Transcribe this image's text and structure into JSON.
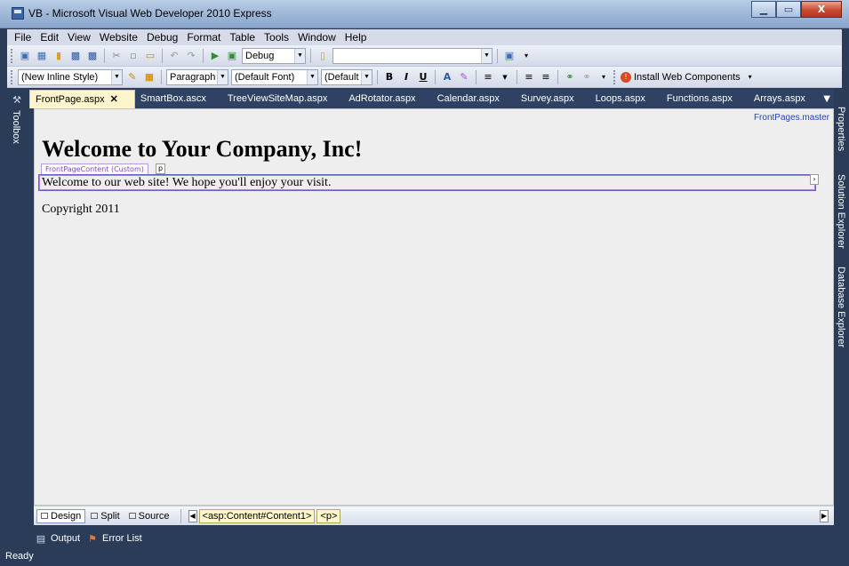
{
  "window": {
    "title": "VB - Microsoft Visual Web Developer 2010 Express",
    "minimize": "▁",
    "restore": "▭",
    "close": "X"
  },
  "menu": [
    "File",
    "Edit",
    "View",
    "Website",
    "Debug",
    "Format",
    "Table",
    "Tools",
    "Window",
    "Help"
  ],
  "toolbar1": {
    "config": "Debug",
    "platform": ""
  },
  "toolbar2": {
    "style": "(New Inline Style)",
    "block": "Paragraph",
    "font": "(Default Font)",
    "size": "(Default",
    "bold": "B",
    "italic": "I",
    "underline": "U",
    "install": "Install Web Components"
  },
  "left_panel": {
    "toolbox": "Toolbox"
  },
  "right_panel": {
    "properties": "Properties",
    "solution": "Solution Explorer",
    "database": "Database Explorer"
  },
  "tabs": [
    "FrontPage.aspx",
    "SmartBox.ascx",
    "TreeViewSiteMap.aspx",
    "AdRotator.aspx",
    "Calendar.aspx",
    "Survey.aspx",
    "Loops.aspx",
    "Functions.aspx",
    "Arrays.aspx"
  ],
  "editor": {
    "master": "FrontPages.master",
    "heading": "Welcome to Your Company, Inc!",
    "content_label": "FrontPageContent (Custom)",
    "p_tag": "p",
    "body_text": "Welcome to our web site! We hope you'll enjoy your visit.",
    "copyright": "Copyright 2011"
  },
  "viewbar": {
    "design": "Design",
    "split": "Split",
    "source": "Source",
    "crumb1": "<asp:Content#Content1>",
    "crumb2": "<p>"
  },
  "bottom": {
    "output": "Output",
    "errors": "Error List"
  },
  "status": "Ready",
  "colors": {
    "chrome": "#2b3c59",
    "active_tab": "#fff5cc",
    "surface": "#eeeeee"
  }
}
